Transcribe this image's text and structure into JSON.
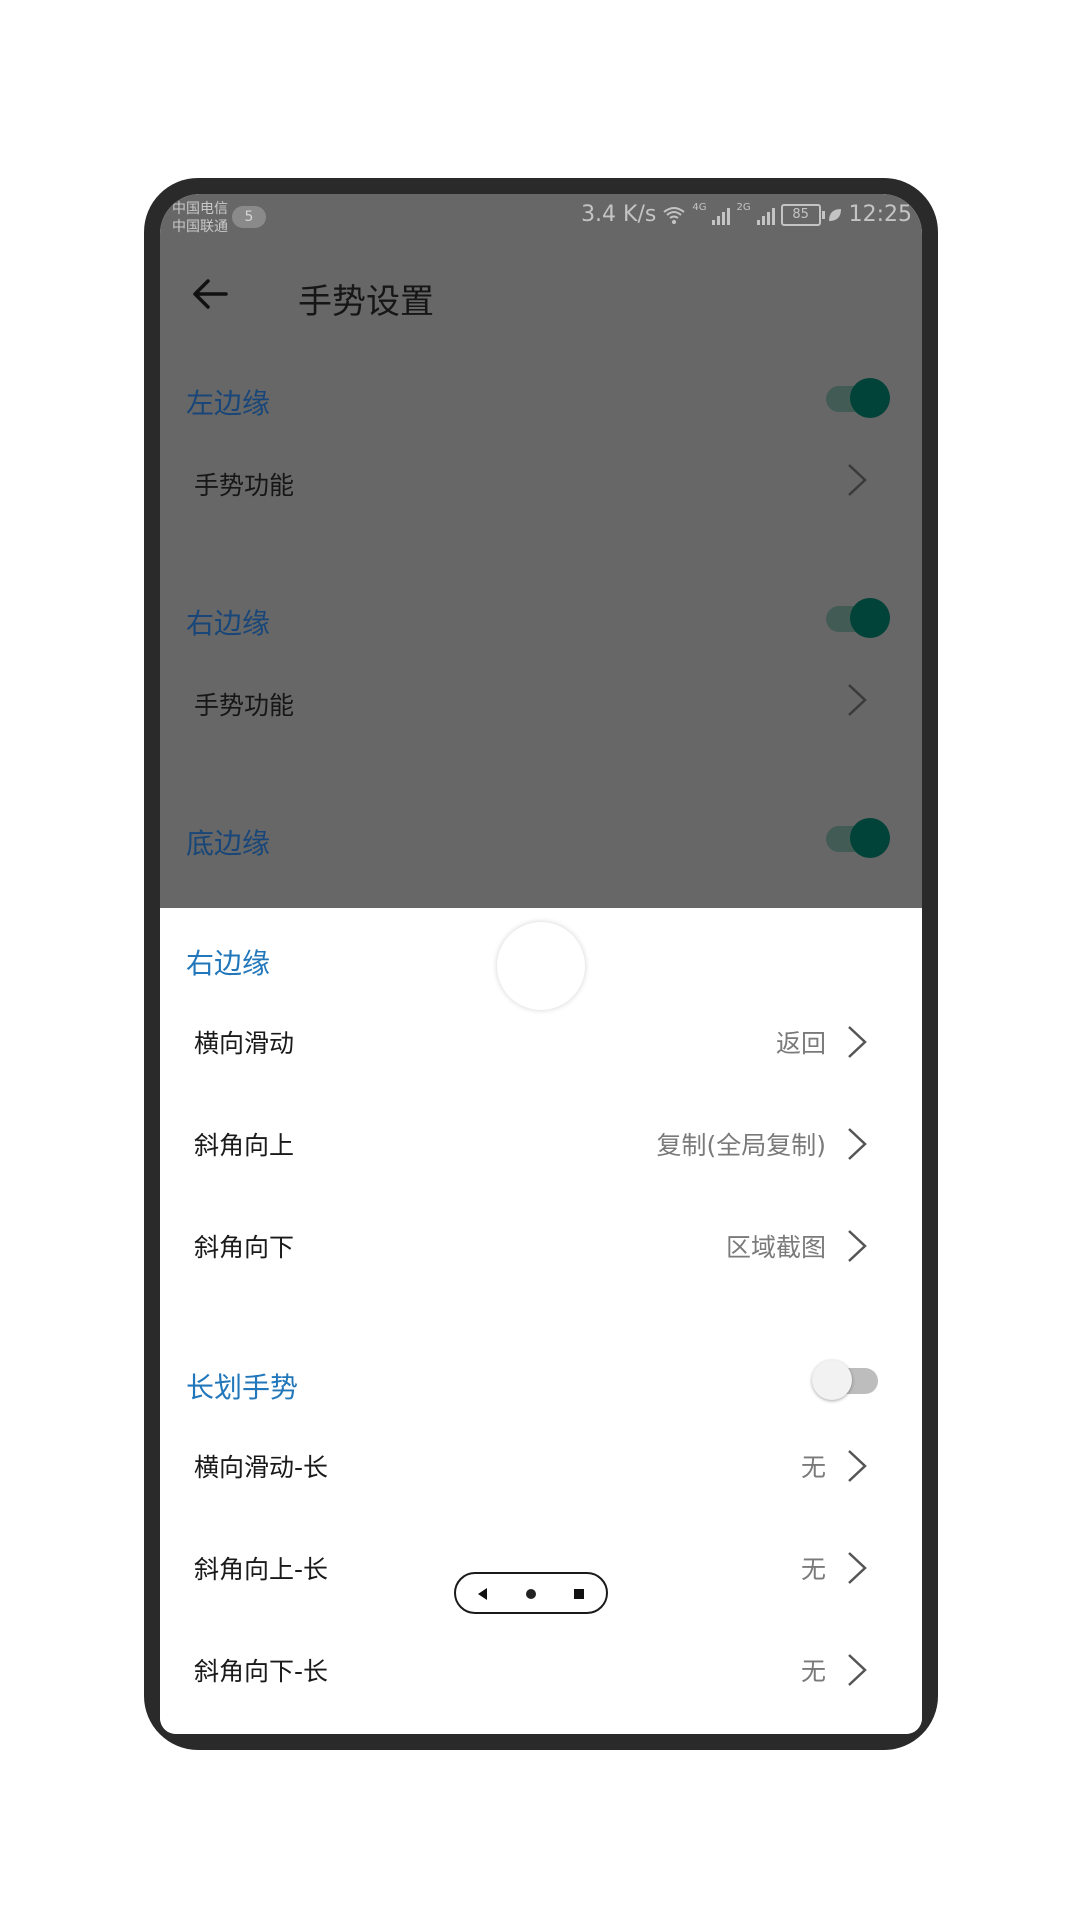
{
  "status_bar": {
    "carrier_1": "中国电信",
    "carrier_2": "中国联通",
    "carrier_badge": "5",
    "net_speed": "3.4 K/s",
    "net_4g": "4G",
    "net_2g": "2G",
    "battery": "85",
    "time": "12:25"
  },
  "app_bar": {
    "back_icon": "arrow-left-icon",
    "title": "手势设置"
  },
  "background_sections": [
    {
      "heading": "左边缘",
      "toggle_on": true,
      "row_label": "手势功能"
    },
    {
      "heading": "右边缘",
      "toggle_on": true,
      "row_label": "手势功能"
    },
    {
      "heading": "底边缘",
      "toggle_on": true
    }
  ],
  "sheet": {
    "section_title": "右边缘",
    "items": [
      {
        "label": "横向滑动",
        "value": "返回"
      },
      {
        "label": "斜角向上",
        "value": "复制(全局复制)"
      },
      {
        "label": "斜角向下",
        "value": "区域截图"
      }
    ],
    "long_section": {
      "title": "长划手势",
      "toggle_on": false,
      "items": [
        {
          "label": "横向滑动-长",
          "value": "无"
        },
        {
          "label": "斜角向上-长",
          "value": "无"
        },
        {
          "label": "斜角向下-长",
          "value": "无"
        }
      ]
    }
  },
  "nav_bar": {
    "buttons": [
      "back-triangle-icon",
      "home-dot-icon",
      "recents-square-icon"
    ]
  },
  "colors": {
    "accent_blue": "#2277bb",
    "toggle_on": "#014239",
    "dim_overlay": "#676767"
  }
}
